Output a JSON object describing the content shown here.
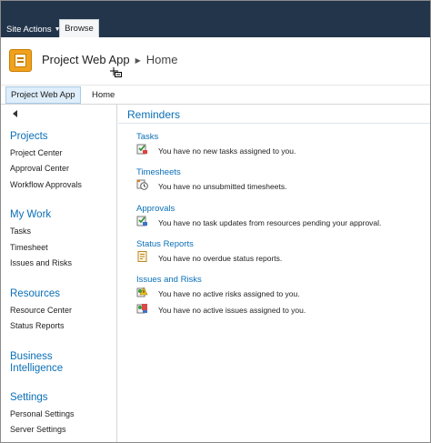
{
  "ribbon": {
    "site_actions": "Site Actions",
    "browse_tab": "Browse"
  },
  "header": {
    "site_title": "Project Web App",
    "page_title": "Home"
  },
  "topnav": {
    "items": [
      {
        "label": "Project Web App"
      },
      {
        "label": "Home"
      }
    ]
  },
  "sidebar": {
    "sections": [
      {
        "heading": "Projects",
        "items": [
          "Project Center",
          "Approval Center",
          "Workflow Approvals"
        ]
      },
      {
        "heading": "My Work",
        "items": [
          "Tasks",
          "Timesheet",
          "Issues and Risks"
        ]
      },
      {
        "heading": "Resources",
        "items": [
          "Resource Center",
          "Status Reports"
        ]
      },
      {
        "heading_line1": "Business",
        "heading_line2": "Intelligence",
        "items": []
      },
      {
        "heading": "Settings",
        "items": [
          "Personal Settings",
          "Server Settings"
        ]
      }
    ]
  },
  "main": {
    "title": "Reminders",
    "sections": [
      {
        "title": "Tasks",
        "rows": [
          {
            "icon": "task-icon",
            "text": "You have no new tasks assigned to you."
          }
        ]
      },
      {
        "title": "Timesheets",
        "rows": [
          {
            "icon": "timesheet-clock-icon",
            "text": "You have no unsubmitted timesheets."
          }
        ]
      },
      {
        "title": "Approvals",
        "rows": [
          {
            "icon": "approval-icon",
            "text": "You have no task updates from resources pending your approval."
          }
        ]
      },
      {
        "title": "Status Reports",
        "rows": [
          {
            "icon": "status-report-icon",
            "text": "You have no overdue status reports."
          }
        ]
      },
      {
        "title": "Issues and Risks",
        "rows": [
          {
            "icon": "risk-icon",
            "text": "You have no active risks assigned to you."
          },
          {
            "icon": "issue-icon",
            "text": "You have no active issues assigned to you."
          }
        ]
      }
    ]
  },
  "colors": {
    "ribbon_bg": "#22354b",
    "link_blue": "#0a6fb7",
    "logo_orange": "#f0a21c"
  }
}
